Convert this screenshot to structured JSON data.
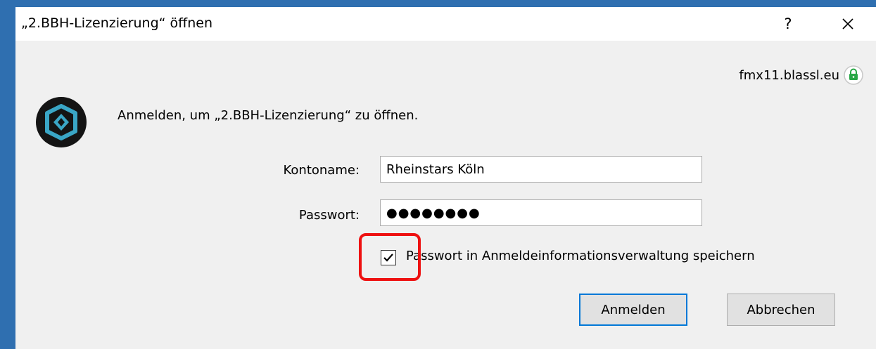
{
  "window": {
    "title": "„2.BBH-Lizenzierung“ öffnen",
    "help_label": "?"
  },
  "server": {
    "host": "fmx11.blassl.eu",
    "lock_color": "#28a745"
  },
  "prompt": {
    "text": "Anmelden, um „2.BBH-Lizenzierung“ zu öffnen."
  },
  "form": {
    "account_label": "Kontoname:",
    "account_value": "Rheinstars Köln",
    "password_label": "Passwort:",
    "password_value": "●●●●●●●●",
    "remember_label": "Passwort in Anmeldeinformationsverwaltung speichern",
    "remember_checked": true
  },
  "buttons": {
    "login_label": "Anmelden",
    "cancel_label": "Abbrechen"
  },
  "annotation": {
    "highlight_color": "#ee1111"
  }
}
